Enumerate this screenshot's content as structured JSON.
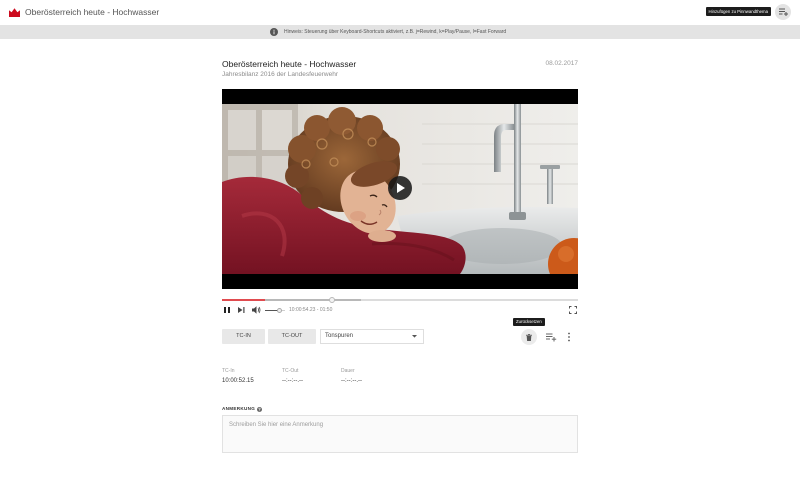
{
  "app": {
    "title": "Oberösterreich heute - Hochwasser",
    "logo_icon": "brand-logo-icon"
  },
  "colors": {
    "brand": "#cc0a1e",
    "progress_highlight": "#e04b4f",
    "notice_background": "#e3e3e3"
  },
  "header": {
    "add_tooltip": "Hinzufügen zu Pinnwandthema",
    "add_icon": "playlist-add-icon"
  },
  "notice": {
    "icon": "info-icon",
    "text": "Hinweis: Steuerung über Keyboard-Shortcuts aktiviert, z.B. j=Rewind, k=Play/Pause, l=Fast Forward"
  },
  "clip": {
    "title": "Oberösterreich heute - Hochwasser",
    "date": "08.02.2017",
    "subtitle": "Jahresbilanz 2016 der Landesfeuerwehr"
  },
  "player": {
    "overlay_icon": "play-icon",
    "progress": {
      "highlight": 0.12,
      "position": 0.31,
      "buffered": 0.39
    },
    "controls": {
      "pause_icon": "pause-icon",
      "next_icon": "skip-next-icon",
      "volume_icon": "volume-icon",
      "fullscreen_icon": "fullscreen-icon"
    },
    "volume": 0.7,
    "time": "10:00:54.23 - 01:50"
  },
  "toolbar": {
    "tc_in": "TC-IN",
    "tc_out": "TC-OUT",
    "track_select": {
      "value": "Tonspuren",
      "icon": "chevron-down-icon"
    },
    "reset_tooltip": "Zurücksetzen",
    "reset_icon": "trash-icon",
    "queue_icon": "playlist-add-icon",
    "more_icon": "more-vert-icon"
  },
  "timecodes": [
    {
      "label": "TC-In",
      "value": "10:00:52.15"
    },
    {
      "label": "TC-Out",
      "value": "--:--:--.--"
    },
    {
      "label": "Dauer",
      "value": "--:--:--.--"
    }
  ],
  "note": {
    "label": "ANMERKUNG",
    "help_icon": "help-icon",
    "placeholder": "Schreiben Sie hier eine Anmerkung",
    "value": ""
  }
}
